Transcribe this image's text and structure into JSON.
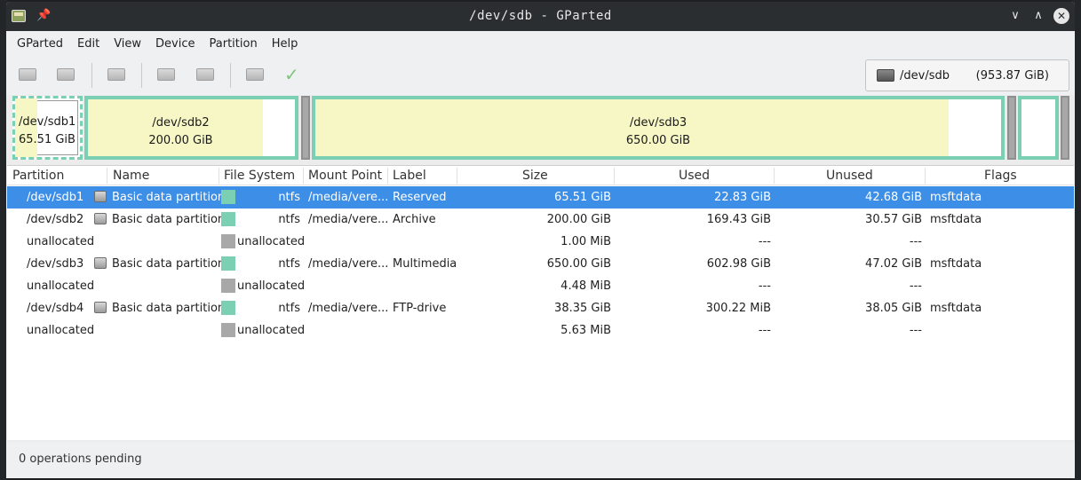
{
  "window": {
    "title": "/dev/sdb - GParted"
  },
  "menu": [
    "GParted",
    "Edit",
    "View",
    "Device",
    "Partition",
    "Help"
  ],
  "device_selector": {
    "name": "/dev/sdb",
    "size": "(953.87 GiB)"
  },
  "disk_map": [
    {
      "label": "/dev/sdb1",
      "size": "65.51 GiB",
      "used_fraction": 0.35,
      "selected": true
    },
    {
      "label": "/dev/sdb2",
      "size": "200.00 GiB",
      "used_fraction": 0.85
    },
    {
      "label": "",
      "size": "",
      "unallocated": true
    },
    {
      "label": "/dev/sdb3",
      "size": "650.00 GiB",
      "used_fraction": 0.93
    },
    {
      "label": "",
      "size": "",
      "unallocated": true
    },
    {
      "label": "",
      "size": "",
      "used_fraction": 0.0
    },
    {
      "label": "",
      "size": "",
      "unallocated": true
    }
  ],
  "columns": [
    "Partition",
    "Name",
    "File System",
    "Mount Point",
    "Label",
    "Size",
    "Used",
    "Unused",
    "Flags"
  ],
  "rows": [
    {
      "partition": "/dev/sdb1",
      "name": "Basic data partition",
      "fs": "ntfs",
      "fs_color": "#7bcfb2",
      "mount": "/media/vere...",
      "label": "Reserved",
      "size": "65.51 GiB",
      "used": "22.83 GiB",
      "unused": "42.68 GiB",
      "flags": "msftdata",
      "selected": true
    },
    {
      "partition": "/dev/sdb2",
      "name": "Basic data partition",
      "fs": "ntfs",
      "fs_color": "#7bcfb2",
      "mount": "/media/vere...",
      "label": "Archive",
      "size": "200.00 GiB",
      "used": "169.43 GiB",
      "unused": "30.57 GiB",
      "flags": "msftdata"
    },
    {
      "partition": "unallocated",
      "name": "",
      "fs": "unallocated",
      "fs_color": "#a8a8a8",
      "mount": "",
      "label": "",
      "size": "1.00 MiB",
      "used": "---",
      "unused": "---",
      "flags": ""
    },
    {
      "partition": "/dev/sdb3",
      "name": "Basic data partition",
      "fs": "ntfs",
      "fs_color": "#7bcfb2",
      "mount": "/media/vere...",
      "label": "Multimedia",
      "size": "650.00 GiB",
      "used": "602.98 GiB",
      "unused": "47.02 GiB",
      "flags": "msftdata"
    },
    {
      "partition": "unallocated",
      "name": "",
      "fs": "unallocated",
      "fs_color": "#a8a8a8",
      "mount": "",
      "label": "",
      "size": "4.48 MiB",
      "used": "---",
      "unused": "---",
      "flags": ""
    },
    {
      "partition": "/dev/sdb4",
      "name": "Basic data partition",
      "fs": "ntfs",
      "fs_color": "#7bcfb2",
      "mount": "/media/vere...",
      "label": "FTP-drive",
      "size": "38.35 GiB",
      "used": "300.22 MiB",
      "unused": "38.05 GiB",
      "flags": "msftdata"
    },
    {
      "partition": "unallocated",
      "name": "",
      "fs": "unallocated",
      "fs_color": "#a8a8a8",
      "mount": "",
      "label": "",
      "size": "5.63 MiB",
      "used": "---",
      "unused": "---",
      "flags": ""
    }
  ],
  "status": {
    "text": "0 operations pending"
  },
  "toolbar_icons": [
    "new-partition-icon",
    "delete-partition-icon",
    "resize-move-icon",
    "copy-icon",
    "paste-icon",
    "undo-icon",
    "apply-checkmark-icon"
  ]
}
